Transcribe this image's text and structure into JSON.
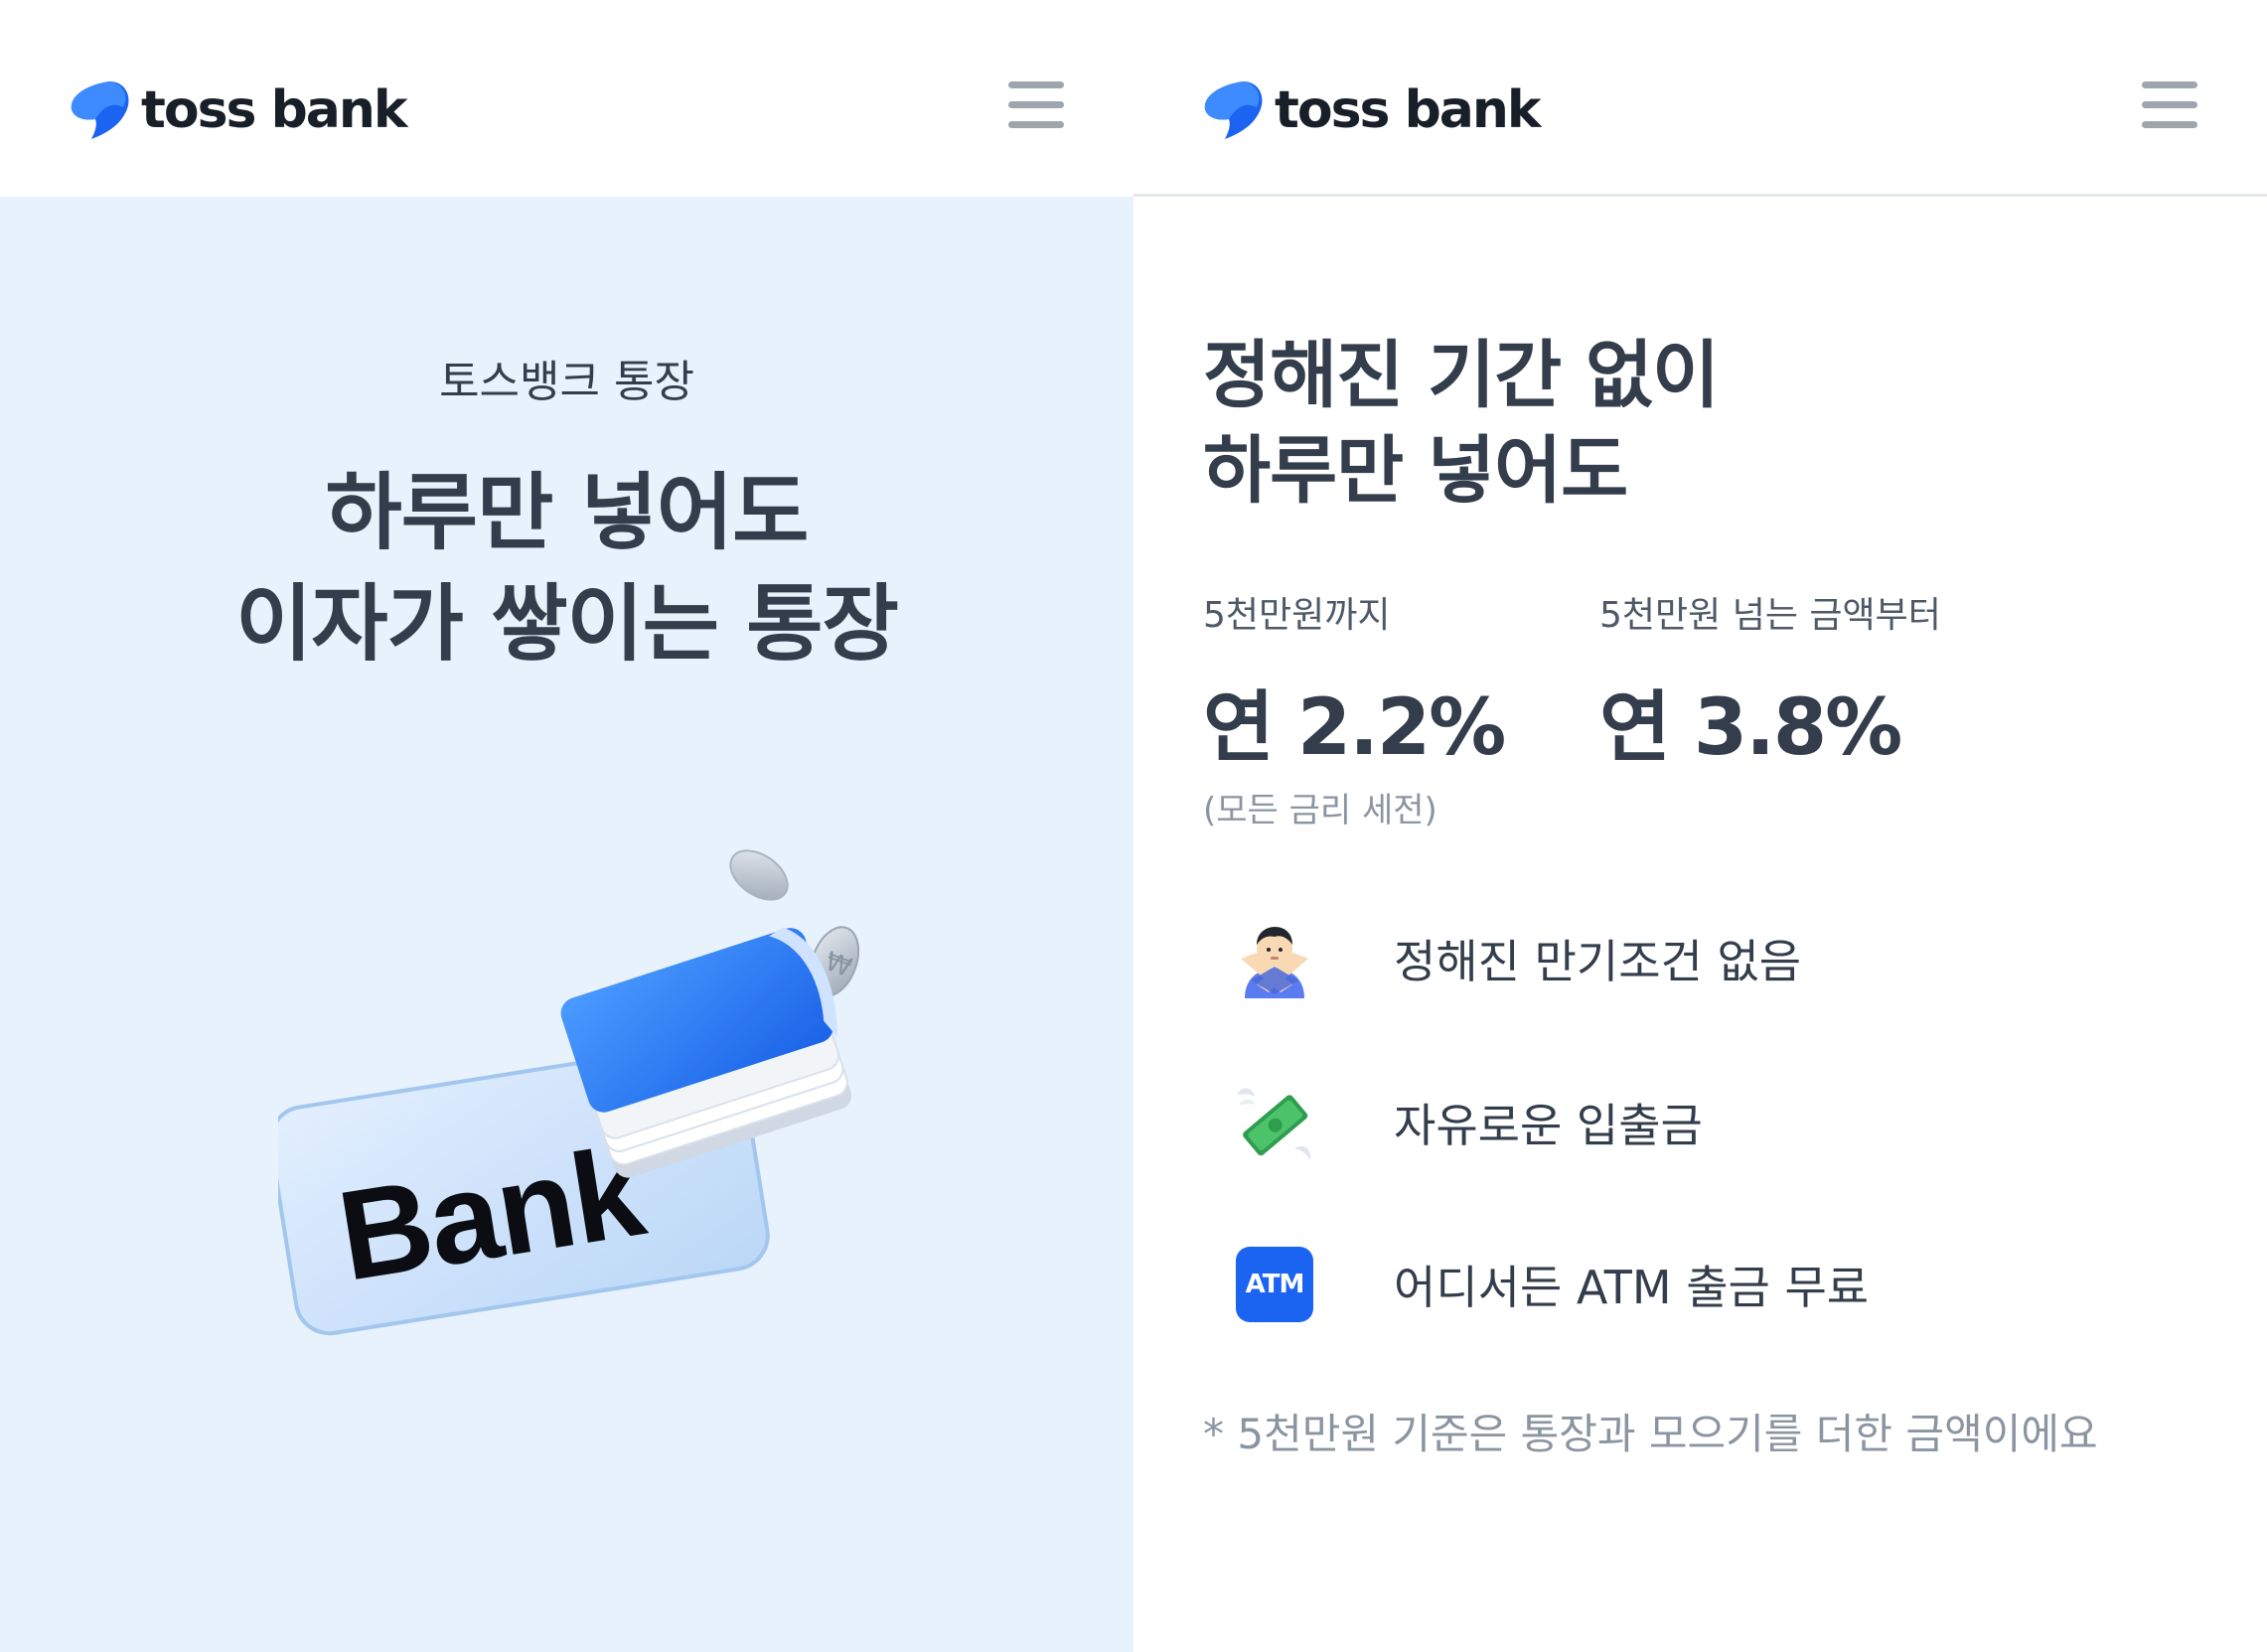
{
  "brand": {
    "name": "toss bank",
    "accent": "#1b64f2"
  },
  "left": {
    "eyebrow": "토스뱅크 통장",
    "title_line1": "하루만 넣어도",
    "title_line2": "이자가 쌓이는 통장",
    "card_text": "Bank",
    "background": "#e8f2fd"
  },
  "right": {
    "title_line1": "정해진 기간 없이",
    "title_line2": "하루만 넣어도",
    "rates": [
      {
        "label": "5천만원까지",
        "value": "연 2.2%",
        "note": "(모든 금리 세전)"
      },
      {
        "label": "5천만원 넘는 금액부터",
        "value": "연 3.8%"
      }
    ],
    "features": [
      {
        "icon": "person-crossed-arms-icon",
        "text": "정해진 만기조건 없음"
      },
      {
        "icon": "flying-money-icon",
        "text": "자유로운 입출금"
      },
      {
        "icon": "atm-icon",
        "icon_label": "ATM",
        "text": "어디서든 ATM 출금 무료"
      }
    ],
    "footnote": "* 5천만원 기준은 통장과 모으기를 더한 금액이에요"
  }
}
